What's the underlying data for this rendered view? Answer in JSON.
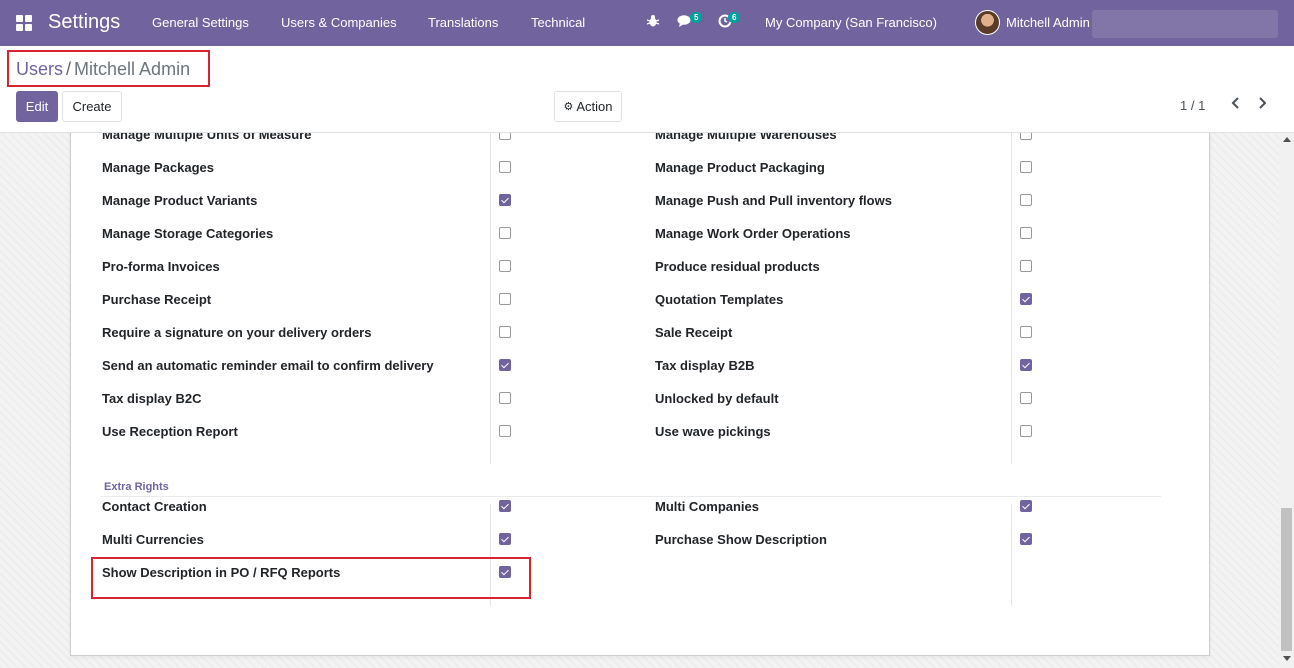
{
  "navbar": {
    "app_title": "Settings",
    "menu": [
      "General Settings",
      "Users & Companies",
      "Translations",
      "Technical"
    ],
    "messages_badge": "5",
    "activities_badge": "6",
    "company": "My Company (San Francisco)",
    "user": "Mitchell Admin"
  },
  "breadcrumb": {
    "parent": "Users",
    "separator": "/",
    "current": "Mitchell Admin"
  },
  "buttons": {
    "edit": "Edit",
    "create": "Create",
    "action": "Action"
  },
  "pager": {
    "value": "1 / 1"
  },
  "icons": {
    "apps": "apps-grid-icon",
    "debug": "bug-icon",
    "messages": "chat-icon",
    "activities": "clock-icon",
    "action": "gear-icon",
    "prev": "chevron-left-icon",
    "next": "chevron-right-icon"
  },
  "colors": {
    "brand": "#71639e",
    "highlight": "#d9232e",
    "badge": "#00a09d"
  },
  "rights": {
    "left": [
      {
        "label": "Manage Multiple Units of Measure",
        "checked": false
      },
      {
        "label": "Manage Packages",
        "checked": false
      },
      {
        "label": "Manage Product Variants",
        "checked": true
      },
      {
        "label": "Manage Storage Categories",
        "checked": false
      },
      {
        "label": "Pro-forma Invoices",
        "checked": false
      },
      {
        "label": "Purchase Receipt",
        "checked": false
      },
      {
        "label": "Require a signature on your delivery orders",
        "checked": false
      },
      {
        "label": "Send an automatic reminder email to confirm delivery",
        "checked": true
      },
      {
        "label": "Tax display B2C",
        "checked": false
      },
      {
        "label": "Use Reception Report",
        "checked": false
      }
    ],
    "right": [
      {
        "label": "Manage Multiple Warehouses",
        "checked": false
      },
      {
        "label": "Manage Product Packaging",
        "checked": false
      },
      {
        "label": "Manage Push and Pull inventory flows",
        "checked": false
      },
      {
        "label": "Manage Work Order Operations",
        "checked": false
      },
      {
        "label": "Produce residual products",
        "checked": false
      },
      {
        "label": "Quotation Templates",
        "checked": true
      },
      {
        "label": "Sale Receipt",
        "checked": false
      },
      {
        "label": "Tax display B2B",
        "checked": true
      },
      {
        "label": "Unlocked by default",
        "checked": false
      },
      {
        "label": "Use wave pickings",
        "checked": false
      }
    ]
  },
  "extra_rights": {
    "title": "Extra Rights",
    "left": [
      {
        "label": "Contact Creation",
        "checked": true
      },
      {
        "label": "Multi Currencies",
        "checked": true
      },
      {
        "label": "Show Description in PO / RFQ Reports",
        "checked": true
      }
    ],
    "right": [
      {
        "label": "Multi Companies",
        "checked": true
      },
      {
        "label": "Purchase Show Description",
        "checked": true
      }
    ]
  }
}
